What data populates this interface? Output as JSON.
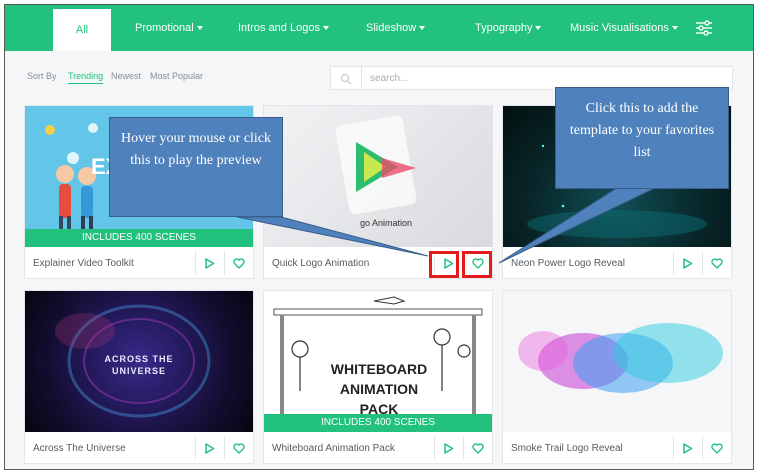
{
  "nav": {
    "items": [
      {
        "label": "All",
        "active": true
      },
      {
        "label": "Promotional",
        "dropdown": true
      },
      {
        "label": "Intros and Logos",
        "dropdown": true
      },
      {
        "label": "Slideshow",
        "dropdown": true
      },
      {
        "label": "Typography",
        "dropdown": true
      },
      {
        "label": "Music Visualisations",
        "dropdown": true
      }
    ],
    "filter_icon": "sliders-icon"
  },
  "sort": {
    "label": "Sort By",
    "options": [
      "Trending",
      "Newest",
      "Most Popular"
    ],
    "selected": "Trending"
  },
  "search": {
    "placeholder": "search...",
    "value": ""
  },
  "cards": [
    {
      "title": "Explainer Video Toolkit",
      "badge": "INCLUDES 400 SCENES",
      "thumb_text": "EX"
    },
    {
      "title": "Quick Logo Animation",
      "badge": "",
      "thumb_text": "go Animation"
    },
    {
      "title": "Neon Power Logo Reveal",
      "badge": ""
    },
    {
      "title": "Across The Universe",
      "badge": "",
      "thumb_text": "ACROSS THE UNIVERSE"
    },
    {
      "title": "Whiteboard Animation Pack",
      "badge": "INCLUDES 400 SCENES",
      "thumb_text": "WHITEBOARD ANIMATION PACK"
    },
    {
      "title": "Smoke Trail Logo Reveal",
      "badge": ""
    }
  ],
  "callouts": {
    "play": "Hover your mouse or click this to play the preview",
    "favorite": "Click this to add the template to your favorites list"
  },
  "colors": {
    "accent": "#22c17e",
    "callout": "#4f81bd",
    "highlight": "#e21c1c"
  }
}
